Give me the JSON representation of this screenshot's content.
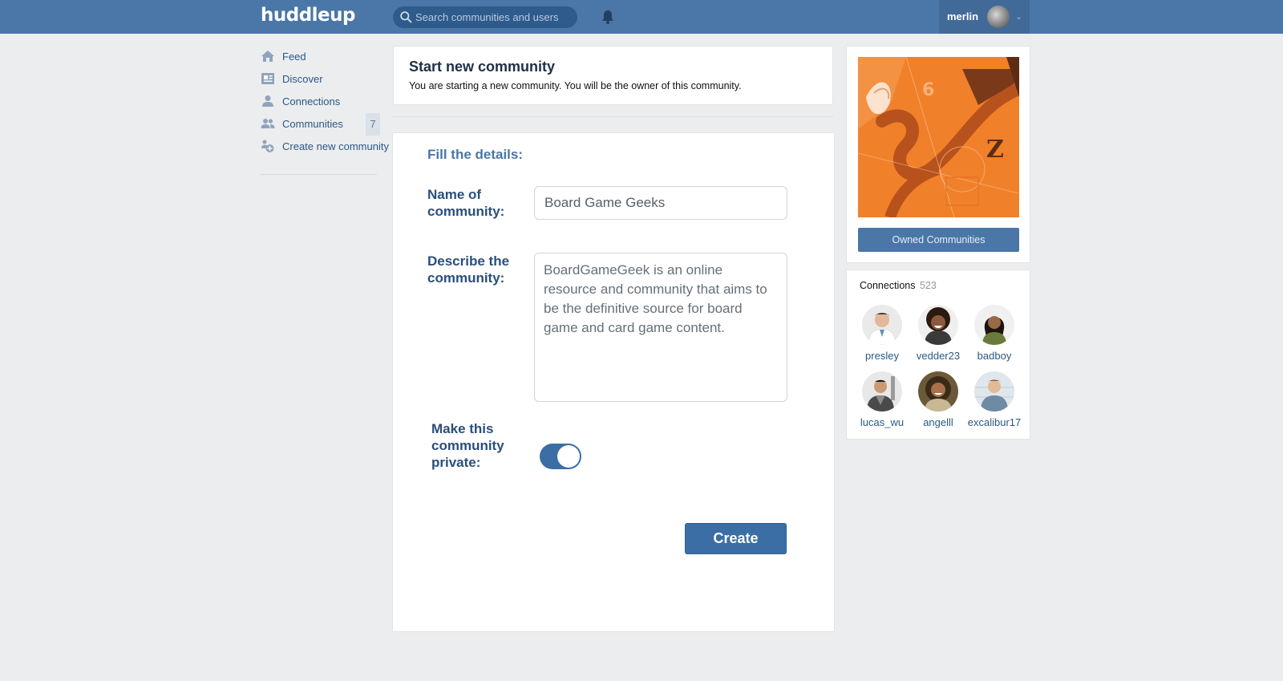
{
  "topbar": {
    "logo": "huddleup",
    "search_placeholder": "Search communities and users",
    "username": "merlin"
  },
  "sidebar": {
    "items": [
      {
        "label": "Feed",
        "icon": "home-icon"
      },
      {
        "label": "Discover",
        "icon": "news-icon"
      },
      {
        "label": "Connections",
        "icon": "user-icon"
      },
      {
        "label": "Communities",
        "icon": "users-icon",
        "badge": "7"
      },
      {
        "label": "Create new community",
        "icon": "create-community-icon"
      }
    ]
  },
  "header": {
    "title": "Start new community",
    "subtitle": "You are starting a new community. You will be the owner of this community."
  },
  "form": {
    "section_title": "Fill the details:",
    "name_label": "Name of community:",
    "name_value": "Board Game Geeks",
    "description_label": "Describe the community:",
    "description_value": "BoardGameGeek is an online resource and community that aims to be the definitive source for board game and card game content.",
    "private_label": "Make this community private:",
    "private_enabled": true,
    "create_label": "Create"
  },
  "owned": {
    "button_label": "Owned Communities"
  },
  "connections": {
    "title": "Connections",
    "count": "523",
    "people": [
      {
        "name": "presley"
      },
      {
        "name": "vedder23"
      },
      {
        "name": "badboy"
      },
      {
        "name": "lucas_wu"
      },
      {
        "name": "angelll"
      },
      {
        "name": "excalibur17"
      }
    ]
  },
  "colors": {
    "brand": "#4a76a8",
    "accent": "#3a6ea5",
    "background": "#ecedef",
    "promo_orange": "#f0812a"
  }
}
